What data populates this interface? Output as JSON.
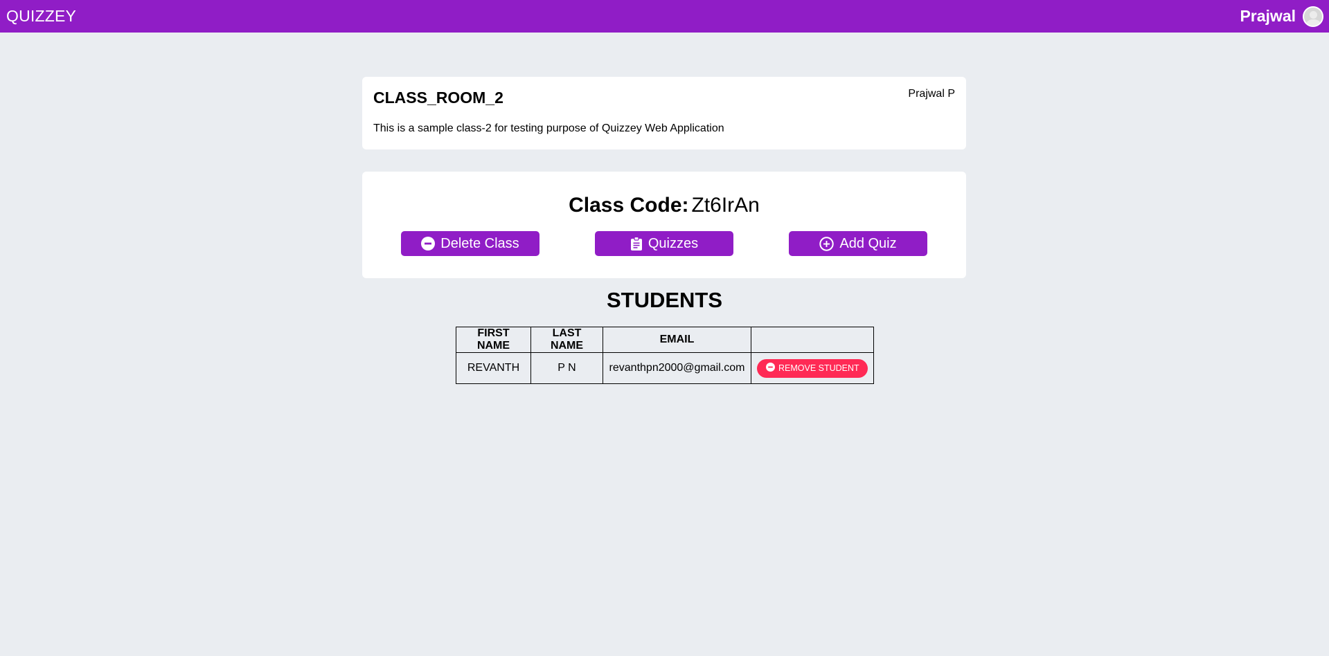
{
  "header": {
    "brand": "QUIZZEY",
    "user_name": "Prajwal",
    "accent_color": "#901dc6"
  },
  "class_card": {
    "title": "CLASS_ROOM_2",
    "owner": "Prajwal P",
    "description": "This is a sample class-2 for testing purpose of Quizzey Web Application"
  },
  "class_code": {
    "label": "Class Code:",
    "value": "Zt6IrAn"
  },
  "actions": {
    "delete_label": "Delete Class",
    "quizzes_label": "Quizzes",
    "add_quiz_label": "Add Quiz",
    "delete_icon": "minus-circle-icon",
    "quizzes_icon": "clipboard-icon",
    "add_quiz_icon": "plus-circle-icon"
  },
  "students": {
    "heading": "STUDENTS",
    "columns": [
      "FIRST NAME",
      "LAST NAME",
      "EMAIL",
      ""
    ],
    "rows": [
      {
        "first_name": "REVANTH",
        "last_name": "P N",
        "email": "revanthpn2000@gmail.com",
        "action_label": "REMOVE STUDENT"
      }
    ],
    "remove_color": "#ff2a55"
  }
}
